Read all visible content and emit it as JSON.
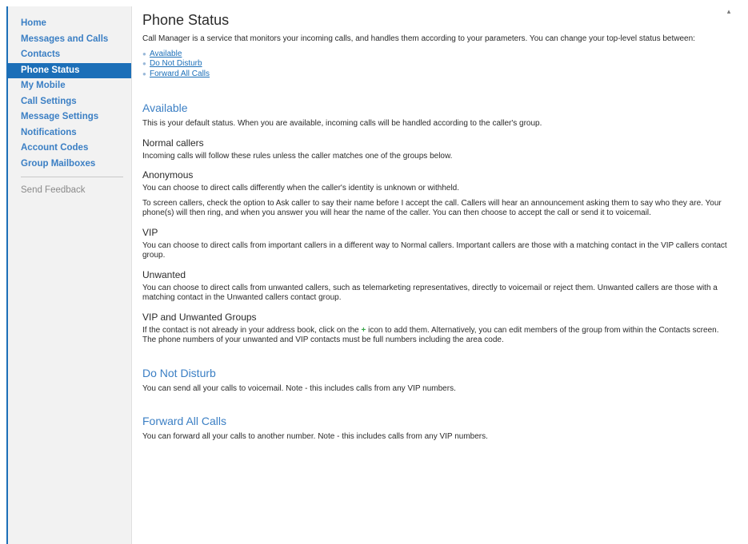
{
  "sidebar": {
    "items": [
      {
        "label": "Home",
        "active": false
      },
      {
        "label": "Messages and Calls",
        "active": false
      },
      {
        "label": "Contacts",
        "active": false
      },
      {
        "label": "Phone Status",
        "active": true
      },
      {
        "label": "My Mobile",
        "active": false
      },
      {
        "label": "Call Settings",
        "active": false
      },
      {
        "label": "Message Settings",
        "active": false
      },
      {
        "label": "Notifications",
        "active": false
      },
      {
        "label": "Account Codes",
        "active": false
      },
      {
        "label": "Group Mailboxes",
        "active": false
      }
    ],
    "feedback": "Send Feedback"
  },
  "main": {
    "title": "Phone Status",
    "intro": "Call Manager is a service that monitors your incoming calls, and handles them according to your parameters. You can change your top-level status between:",
    "status_links": [
      "Available",
      "Do Not Disturb",
      "Forward All Calls"
    ],
    "available": {
      "heading": "Available",
      "text": "This is your default status. When you are available, incoming calls will be handled according to the caller's group.",
      "normal": {
        "heading": "Normal callers",
        "text": "Incoming calls will follow these rules unless the caller matches one of the groups below."
      },
      "anonymous": {
        "heading": "Anonymous",
        "text1": "You can choose to direct calls differently when the caller's identity is unknown or withheld.",
        "text2": "To screen callers, check the option to Ask caller to say their name before I accept the call. Callers will hear an announcement asking them to say who they are. Your phone(s) will then ring, and when you answer you will hear the name of the caller. You can then choose to accept the call or send it to voicemail."
      },
      "vip": {
        "heading": "VIP",
        "text": "You can choose to direct calls from important callers in a different way to Normal callers. Important callers are those with a matching contact in the VIP callers contact group."
      },
      "unwanted": {
        "heading": "Unwanted",
        "text": "You can choose to direct calls from unwanted callers, such as telemarketing representatives, directly to voicemail or reject them. Unwanted callers are those with a matching contact in the Unwanted callers contact group."
      },
      "groups": {
        "heading": "VIP and Unwanted Groups",
        "text_before": "If the contact is not already in your address book, click on the ",
        "plus": "+",
        "text_after": " icon to add them. Alternatively, you can edit members of the group from within the Contacts screen. The phone numbers of your unwanted and VIP contacts must be full numbers including the area code."
      }
    },
    "dnd": {
      "heading": "Do Not Disturb",
      "text": "You can send all your calls to voicemail. Note - this includes calls from any VIP numbers."
    },
    "forward": {
      "heading": "Forward All Calls",
      "text": "You can forward all your calls to another number. Note - this includes calls from any VIP numbers."
    }
  },
  "colors": {
    "accent": "#1c6fb8",
    "link": "#3b7fc4",
    "sidebar_bg": "#f2f2f2",
    "plus": "#3aa64a"
  },
  "icons": {
    "bullet": "dot-bullet-icon",
    "scroll": "scroll-up-arrow-icon"
  }
}
